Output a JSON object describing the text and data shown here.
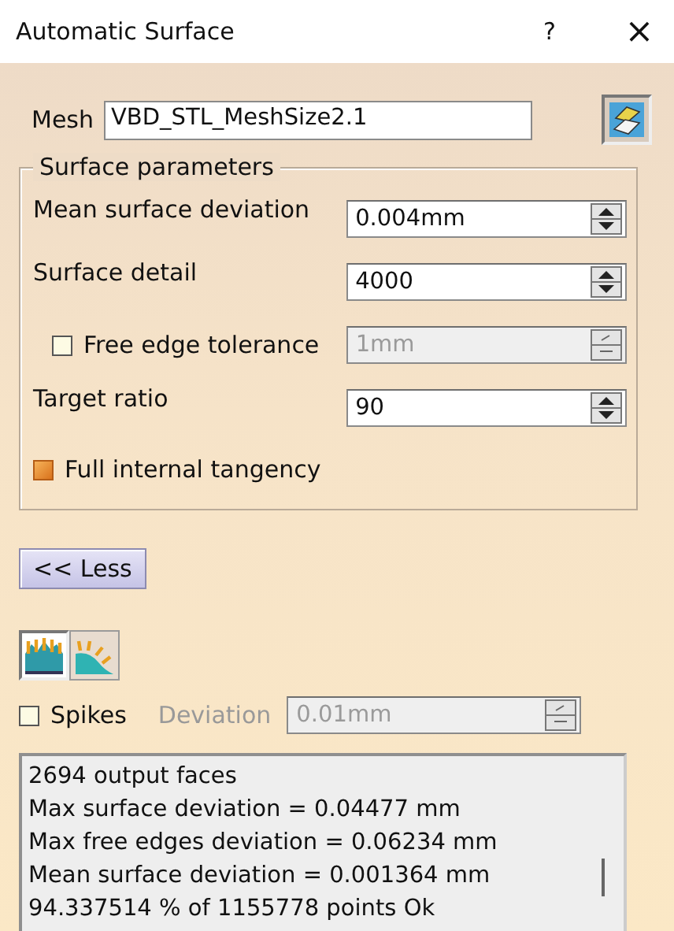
{
  "window": {
    "title": "Automatic Surface",
    "help": "?",
    "close": "×"
  },
  "mesh": {
    "label": "Mesh",
    "value": "VBD_STL_MeshSize2.1"
  },
  "surface_parameters": {
    "title": "Surface parameters",
    "rows": [
      {
        "kind": "spin",
        "label": "Mean surface deviation",
        "value": "0.004mm",
        "disabled": false
      },
      {
        "kind": "spin",
        "label": "Surface detail",
        "value": "4000",
        "disabled": false
      },
      {
        "kind": "check-spin",
        "label": "Free edge tolerance",
        "checked": false,
        "value": "1mm",
        "disabled": true
      },
      {
        "kind": "spin",
        "label": "Target ratio",
        "value": "90",
        "disabled": false
      },
      {
        "kind": "check",
        "label": "Full internal tangency",
        "checked": true
      }
    ]
  },
  "less_button": "<< Less",
  "mode_icons": [
    {
      "selected": true
    },
    {
      "selected": false
    }
  ],
  "spikes": {
    "label": "Spikes",
    "checked": false,
    "deviation_label": "Deviation",
    "value": "0.01mm",
    "disabled": true
  },
  "output": {
    "lines": [
      "2694 output faces",
      "Max surface deviation = 0.04477 mm",
      "Max free edges deviation = 0.06234 mm",
      "Mean surface deviation = 0.001364 mm",
      "94.337514 % of 1155778 points Ok"
    ]
  }
}
